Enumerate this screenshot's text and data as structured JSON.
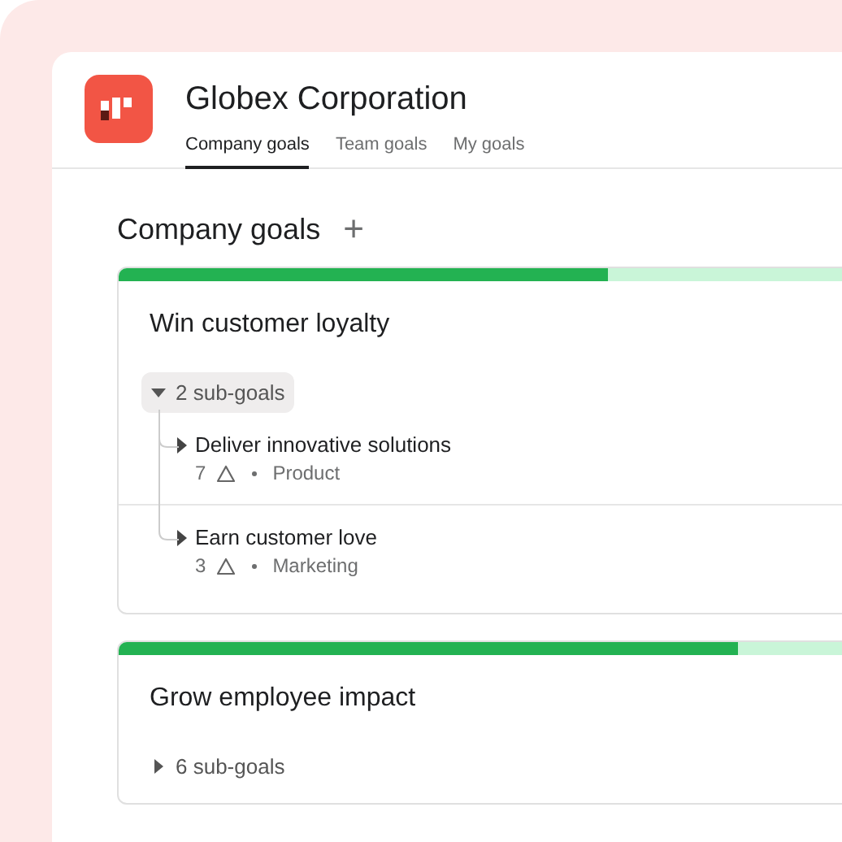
{
  "header": {
    "org": "Globex Corporation",
    "tabs": [
      {
        "label": "Company goals",
        "selected": true
      },
      {
        "label": "Team goals",
        "selected": false
      },
      {
        "label": "My goals",
        "selected": false
      }
    ]
  },
  "section": {
    "title": "Company goals",
    "add": "+"
  },
  "goals": [
    {
      "title": "Win customer loyalty",
      "level": 0.64,
      "subgoals_label": "2 sub-goals",
      "expanded": true,
      "children": [
        {
          "title": "Deliver innovative solutions",
          "count": "7",
          "team": "Product"
        },
        {
          "title": "Earn customer love",
          "count": "3",
          "team": "Marketing"
        }
      ]
    },
    {
      "title": "Grow employee impact",
      "level": 0.81,
      "subgoals_label": "6 sub-goals",
      "expanded": false
    }
  ]
}
